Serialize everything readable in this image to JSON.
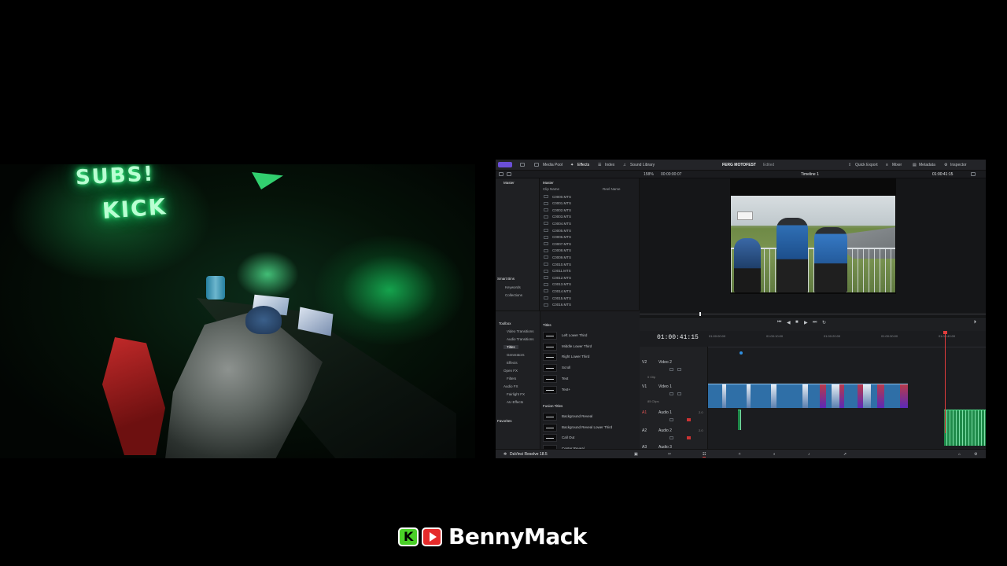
{
  "camera": {
    "neon_top": "SUBS!",
    "neon_bottom": "KICK"
  },
  "resolve": {
    "topbar": {
      "media_pool": "Media Pool",
      "effects": "Effects",
      "index": "Index",
      "sound_library": "Sound Library",
      "project_name": "FERG MOTOFEST",
      "project_status": "Edited",
      "quick_export": "Quick Export",
      "mixer": "Mixer",
      "metadata": "Metadata",
      "inspector": "Inspector"
    },
    "subbar": {
      "zoom": "158%",
      "source_tc": "00:00:00:07",
      "timeline_name": "Timeline 1",
      "record_tc": "01:00:41:15"
    },
    "bins": {
      "master": "Master",
      "smart_bins": "Smart Bins",
      "keywords": "Keywords",
      "collections": "Collections"
    },
    "clip_list": {
      "header": "Master",
      "col_name": "Clip Name",
      "col_reel": "Reel Name",
      "clips": [
        "C0000.MTS",
        "C0001.MTS",
        "C0002.MTS",
        "C0003.MTS",
        "C0004.MTS",
        "C0005.MTS",
        "C0006.MTS",
        "C0007.MTS",
        "C0008.MTS",
        "C0009.MTS",
        "C0010.MTS",
        "C0011.MTS",
        "C0012.MTS",
        "C0013.MTS",
        "C0014.MTS",
        "C0015.MTS",
        "C0016.MTS"
      ]
    },
    "effects": {
      "toolbox": "Toolbox",
      "video_transitions": "Video Transitions",
      "audio_transitions": "Audio Transitions",
      "titles": "Titles",
      "generators": "Generators",
      "effects": "Effects",
      "open_fx": "Open FX",
      "filters": "Filters",
      "audio_fx": "Audio FX",
      "fairlight_fx": "Fairlight FX",
      "au_effects": "AU Effects",
      "favorites": "Favorites",
      "titles_header": "Titles",
      "titles_list": [
        "Left Lower Third",
        "Middle Lower Third",
        "Right Lower Third",
        "Scroll",
        "Text",
        "Text+"
      ],
      "fusion_header": "Fusion Titles",
      "fusion_list": [
        "Background Reveal",
        "Background Reveal Lower Third",
        "Call Out",
        "Center Reveal"
      ]
    },
    "timeline": {
      "timecode": "01:00:41:15",
      "ruler": [
        "01:00:00:00",
        "01:00:10:00",
        "01:00:20:00",
        "01:00:30:00",
        "01:00:40:00"
      ],
      "v2": "V2",
      "video2": "Video 2",
      "v2_clips": "0 Clip",
      "v1": "V1",
      "video1": "Video 1",
      "v1_clips": "85 Clips",
      "a1": "A1",
      "audio1": "Audio 1",
      "a2": "A2",
      "audio2": "Audio 2",
      "a3_label": "A3",
      "audio3": "Audio 3",
      "a1_level": "2.0",
      "a2_level": "2.0"
    },
    "footer": {
      "app_version": "DaVinci Resolve 18.5"
    },
    "colors": {
      "accent": "#6b4fd8",
      "clip_blue": "#2f6fa7",
      "clip_audio": "#1f8a4a",
      "playhead": "#e03c3c"
    }
  },
  "watermark": {
    "brand": "BennyMack",
    "icons": [
      "kick-icon",
      "youtube-icon"
    ]
  }
}
